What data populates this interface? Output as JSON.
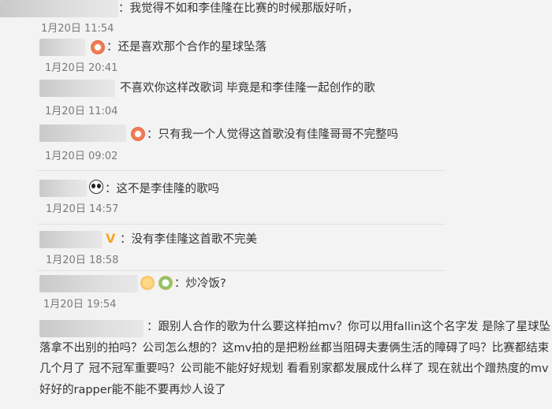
{
  "comments": [
    {
      "text": "：我觉得不如和李佳隆在比赛的时候那版好听，",
      "time": "1月20日 11:54"
    },
    {
      "text": "：还是喜欢那个合作的星球坠落",
      "time": "1月20日 20:41"
    },
    {
      "text": "不喜欢你这样改歌词  毕竟是和李佳隆一起创作的歌",
      "time": "1月20日 11:04"
    },
    {
      "text": "：只有我一个人觉得这首歌没有佳隆哥哥不完整吗",
      "time": "1月20日 09:02"
    },
    {
      "text": "：这不是李佳隆的歌吗",
      "time": "1月20日 14:57"
    },
    {
      "text": "：没有李佳隆这首歌不完美",
      "time": "1月20日 18:58"
    },
    {
      "text": "：炒冷饭?",
      "time": "1月20日 19:54"
    },
    {
      "text": "：跟别人合作的歌为什么要这样拍mv？你可以用fallin这个名字发 是除了星球坠落拿不出别的拍吗？公司怎么想的？这mv拍的是把粉丝都当阻碍夫妻俩生活的障碍了吗？比赛都结束几个月了 冠不冠军重要吗？公司能不能好好规划 看看别家都发展成什么样了 现在就出个蹭热度的mv 好好的rapper能不能不要再炒人设了"
    }
  ],
  "icons": {
    "badge_v": "V",
    "badge_panda": "panda-icon"
  }
}
